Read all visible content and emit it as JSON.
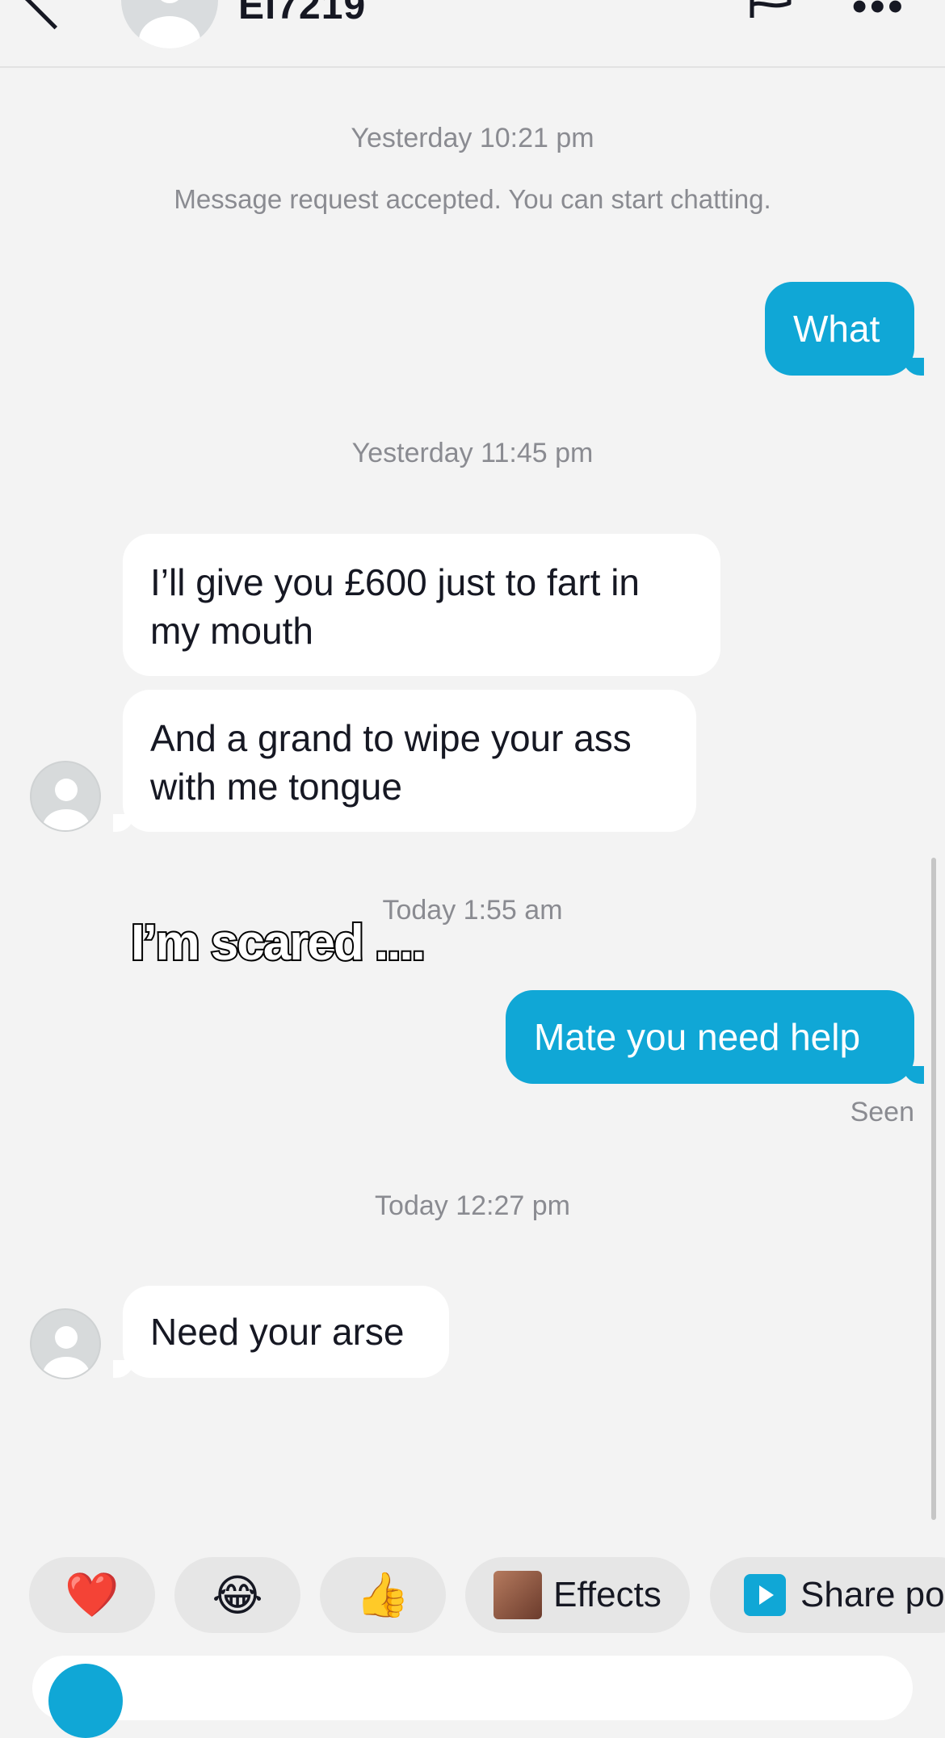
{
  "header": {
    "username": "Ei7219",
    "back_icon": "back-chevron-icon",
    "flag_icon": "flag-icon",
    "more_icon": "more-icon",
    "more_label": "•••"
  },
  "timestamps": {
    "t1": "Yesterday 10:21 pm",
    "t2": "Yesterday 11:45 pm",
    "t3": "Today 1:55 am",
    "t4": "Today 12:27 pm"
  },
  "system_message": "Message request accepted. You can start chatting.",
  "messages": [
    {
      "direction": "out",
      "text": "What"
    },
    {
      "direction": "in",
      "text": "I’ll give you £600 just to fart in my mouth"
    },
    {
      "direction": "in",
      "text": "And a grand to wipe your ass with me tongue"
    },
    {
      "direction": "out",
      "text": "Mate you need help"
    },
    {
      "direction": "in",
      "text": "Need your arse"
    }
  ],
  "seen_label": "Seen",
  "overlay_caption": "I’m scared ....",
  "quick_reactions": {
    "heart": "❤️",
    "laugh": "😂",
    "thumbs": "👍",
    "effects_label": "Effects",
    "share_label": "Share pos"
  },
  "colors": {
    "accent": "#10a7d6",
    "background": "#f3f3f3",
    "incoming_bubble": "#ffffff",
    "meta_text": "#8a8b91"
  }
}
